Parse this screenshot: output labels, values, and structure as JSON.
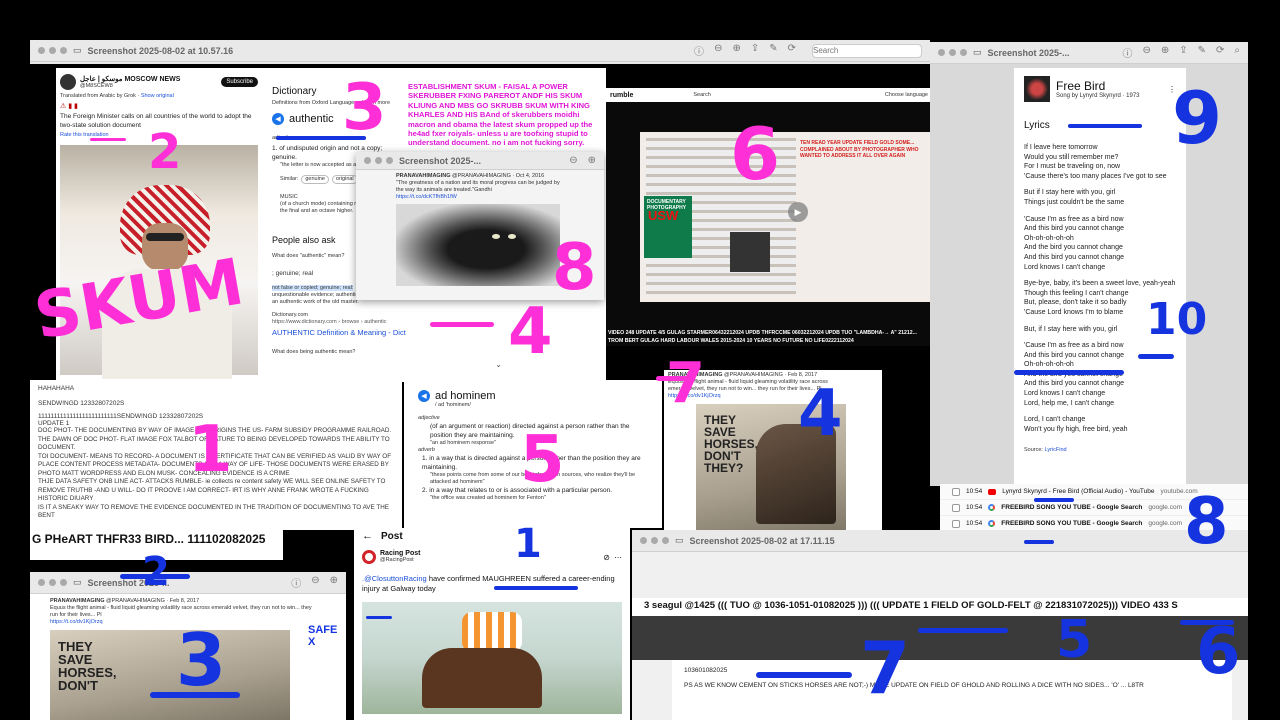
{
  "top_window": {
    "title": "Screenshot 2025-08-02 at 10.57.16",
    "search_placeholder": "Search"
  },
  "tweet_moscow": {
    "name": "MOSCOW NEWS",
    "arabic_name": "موسكو | عاجل",
    "handle": "@M8SCEW8",
    "subscribe": "Subscribe",
    "translated_note": "Translated from Arabic by Grok",
    "show_original": "Show original",
    "body": "The Foreign Minister calls on all countries of the world to adopt the two-state solution document",
    "rate": "Rate this translation"
  },
  "dictionary": {
    "heading": "Dictionary",
    "source": "Definitions from Oxford Languages · Learn more",
    "word": "authentic",
    "pos": "adjective",
    "sense1": "of undisputed origin and not a copy; genuine.",
    "example1": "\"the letter is now accepted as authentic\"",
    "similar_label": "Similar:",
    "similar1": "genuine",
    "similar2": "original",
    "music_label": "MUSIC",
    "music_sense": "(of a church mode) containing notes between the final and an octave higher.",
    "octave": "an octave higher.",
    "people_ask": "People also ask",
    "q1": "What does \"authentic\" mean?",
    "a1": "; genuine; real",
    "a2_hl": "not false or copied; genuine; real:",
    "a2_rest": "unquestionable evidence; authenticated; verified: an authentic document of the Middle Ages; an authentic work of the old master.",
    "source_site": "Dictionary.com",
    "source_url": "https://www.dictionary.com › browse › authentic",
    "result_title": "AUTHENTIC Definition & Meaning - Dictionary.com",
    "q2": "What does being authentic mean?"
  },
  "pink_caption": "ESTABLISHMENT SKUM - FAISAL A POWER SKERUBBER FXING PAREROT ANDF HIS SKUM KLIUNG AND MBS GO SKRUBB SKUM WITH KING KHARLES AND HIS BAnd of skerubbers moidhi macron and obama the latest skum propped up the he4ad fxer roiyals- unless u are toofxing stupid to understand document. no i am not fucking sorry.",
  "cat_window": {
    "title": "Screenshot 2025-...",
    "name": "PRANAVAHIMAGING",
    "handle": "@PRANAVAHIMAGING · Oct 4, 2016",
    "quote": "\"The greatness of a nation and its moral progress can be judged by the way its animals are treated.\"Gandhi",
    "url": "https://t.co/dcKTfhBh1fW"
  },
  "rumble": {
    "logo": "rumble",
    "choose_lang": "Choose language",
    "search": "Search",
    "caption1": "VIDEO 248 UPDATE 4/5 GULAG STARMER06432212024 UPDB THFRCCME 06032212024 UPDB TUO \"LAMBDHA-→ A\" 21212...",
    "caption2": "TROM BERT GULAG HARD LABOUR WALES 2015-2024 10 YEARS NO FUTURE NO LIFE0222112024",
    "doc_label": "DOCUMENTARY PHOTOGRAPHY",
    "red_text": "TEN READ YEAR UPDATE FIELD GOLD SOME... COMPLAINED ABOUT BY PHOTOGRAPHER WHO WANTED TO ADDRESS IT ALL OVER AGAIN",
    "usw": "USW"
  },
  "freebird": {
    "window_title": "Screenshot 2025-...",
    "song": "Free Bird",
    "meta": "Song by Lynyrd Skynyrd · 1973",
    "lyrics_heading": "Lyrics",
    "verses": [
      [
        "If I leave here tomorrow",
        "Would you still remember me?",
        "For I must be traveling on, now",
        "'Cause there's too many places I've got to see"
      ],
      [
        "But if I stay here with you, girl",
        "Things just couldn't be the same"
      ],
      [
        "'Cause I'm as free as a bird now",
        "And this bird you cannot change",
        "Oh-oh-oh-oh-oh",
        "And the bird you cannot change",
        "And this bird you cannot change",
        "Lord knows I can't change"
      ],
      [
        "Bye-bye, baby, it's been a sweet love, yeah-yeah",
        "Though this feeling I can't change",
        "But, please, don't take it so badly",
        "'Cause Lord knows I'm to blame"
      ],
      [
        "But, if I stay here with you, girl"
      ],
      [
        "'Cause I'm as free as a bird now",
        "And this bird you cannot change",
        "Oh-oh-oh-oh-oh",
        "And the bird you cannot change",
        "And this bird you cannot change",
        "Lord knows I can't change",
        "Lord, help me, I can't change"
      ],
      [
        "Lord, I can't change",
        "Won't you fly high, free bird, yeah"
      ]
    ],
    "source_label": "Source:",
    "source": "LyricFind"
  },
  "history": [
    {
      "time": "10:54",
      "title": "Lynyrd Skynyrd - Free Bird (Official Audio) - YouTube",
      "site": "youtube.com",
      "icon": "youtube-icon"
    },
    {
      "time": "10:54",
      "title": "FREEBIRD SONG YOU TUBE - Google Search",
      "site": "google.com",
      "icon": "google-icon"
    },
    {
      "time": "10:54",
      "title": "FREEBIRD SONG YOU TUBE - Google Search",
      "site": "google.com",
      "icon": "google-icon"
    }
  ],
  "notes": {
    "hahaha": "HAHAHAHA",
    "code": "SENDW!NGD 12332807202S",
    "ones": "1111111111111111111111111SENDW!NGD 12332807202S",
    "update": "UPDATE 1",
    "lines": [
      "DOC PHOT- THE DOCUMENTING BY WAY OF IMAGE- ITS ORIGINS THE US- FARM SUBSIDY PROGRAMME RAILROAD.",
      "THE DAWN OF DOC PHOT- FLAT IMAGE FOX TALBOT OF NATURE TO BEING DEVELOPED TOWARDS THE ABILITY TO DOCUMENT.",
      "TOI DOCUMENT- MEANS TO RECORD- A DOCUMENT IS A CERTIFICATE THAT CAN BE VERIFIED AS VALID BY WAY OF PLACE CONTENT PROCESS METADATA- DOCUMENTS ARE A WAY OF LIFE- THOSE DOCUMENTS WERE ERASED BY PHOTO MATT WORDPRESS AND ELON MUSK- CONCEALING EVIDENCE IS A CRIME",
      "THJE DATA SAFETY ONB LINE ACT- ATTACKS RUMBLE- ie collects re content safety WE WILL SEE ONLINE SAFETY TO REMOVE TRUTHB -AND U WILL- DO IT PROOVE I AM CORRECT- IRT IS WHY ANNE FRANK WROTE A FUCKING HISTORIC DIUARY",
      "IS IT A SNEAKY WAY TO REMOVE THE EVIDENCE DOCUMENTED IN THE TRADITION OF DOCUMENTING TO AVE THE BENT"
    ]
  },
  "big_caption": "G PHeART THFR33 BIRD... 111102082025",
  "ad_hominem": {
    "word": "ad hominem",
    "pron": "/ ad 'hominem/",
    "pos": "adjective",
    "def1": "(of an argument or reaction) directed against a person rather than the position they are maintaining.",
    "ex1": "\"an ad hominem response\"",
    "adverb": "adverb",
    "def2": "in a way that is directed against a person rather than the position they are maintaining.",
    "ex2": "\"these points come from some of our best information sources, who realize they'll be attacked ad hominem\"",
    "def3": "in a way that relates to or is associated with a particular person.",
    "ex3": "\"the office was created ad hominem for Fenton\""
  },
  "horses_tweet": {
    "name": "PRANAVAHIMAGING",
    "handle": "@PRANAVAHIMAGING · Feb 8, 2017",
    "text": "Equus the flight animal - fluid liquid gleaming volatility race across emerald velvet, they run not to win... they run for their lives... Pl",
    "url": "https://t.co/dv1KjOrzq",
    "headline": "THEY SAVE HORSES, DON'T THEY?"
  },
  "bottom_left_window": {
    "title": "Screenshot 2025-...",
    "name": "PRANAVAHIMAGING",
    "handle": "@PRANAVAHIMAGING · Feb 8, 2017",
    "text": "Equus the flight animal - fluid liquid gleaming volatility race across emerald velvet, they run not to win... they run for their lives... Pl",
    "url": "https://t.co/dv1KjOrzq",
    "headline": "THEY SAVE HORSES, DON'T",
    "safe": "SAFE X"
  },
  "racing_post": {
    "header": "Post",
    "name": "Racing Post",
    "handle": "@RacingPost",
    "mention": ".@ClosuttonRacing",
    "text_mid": " have confirmed ",
    "horse": "MAUGHREEN",
    "text_end": " suffered a career-ending injury at Galway today"
  },
  "bottom_right_window": {
    "title": "Screenshot 2025-08-02 at 17.11.15",
    "seagul": "3 seagul @1425 ((( TUO @ 1036-1051-01082025 ))) ((( UPDATE 1 FIELD OF GOLD-FELT @ 221831072025))) VIDEO 433 S",
    "date": "103601082025",
    "ps": "PS AS WE KNOW CEMENT ON STICKS HORSES ARE NOT;-) MORE UPDATE ON FIELD OF GHOLD AND ROLLING A DICE WITH NO SIDES... 'O' ... L8TR"
  },
  "annotations": {
    "skum": "SKUM",
    "n1": "1",
    "n2": "2",
    "n3": "3",
    "n4": "4",
    "n5": "5",
    "n6": "6",
    "n7": "7",
    "n8": "8",
    "n9": "9",
    "n10": "10"
  },
  "colors": {
    "pink": "#ff2fd7",
    "blue": "#1534e0",
    "link": "#1a4fd6",
    "dark_bg": "#000000"
  }
}
